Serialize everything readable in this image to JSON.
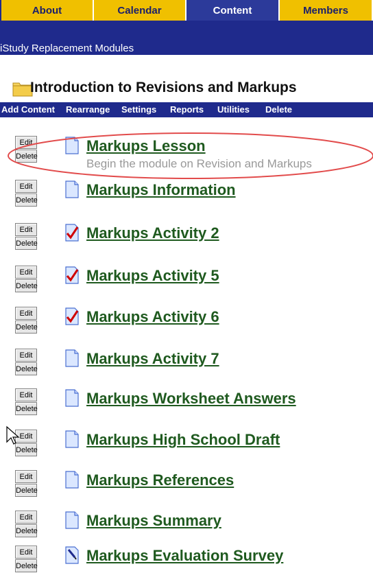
{
  "top_tabs": [
    {
      "label": "About",
      "active": false
    },
    {
      "label": "Calendar",
      "active": false
    },
    {
      "label": "Content",
      "active": true
    },
    {
      "label": "Members",
      "active": false
    }
  ],
  "subheader": {
    "title": "iStudy Replacement Modules"
  },
  "module": {
    "title": "Introduction to Revisions and Markups"
  },
  "toolbar": {
    "items": [
      "Add Content",
      "Rearrange",
      "Settings",
      "Reports",
      "Utilities",
      "Delete"
    ]
  },
  "content_items": [
    {
      "title": "Markups Lesson",
      "description": "Begin the module on Revision and Markups",
      "icon": "page-icon"
    },
    {
      "title": "Markups Information",
      "description": "",
      "icon": "page-icon"
    },
    {
      "title": "Markups Activity 2",
      "description": "",
      "icon": "checkmark-icon"
    },
    {
      "title": "Markups Activity 5",
      "description": "",
      "icon": "checkmark-icon"
    },
    {
      "title": "Markups Activity 6",
      "description": "",
      "icon": "checkmark-icon"
    },
    {
      "title": "Markups Activity 7",
      "description": "",
      "icon": "page-icon"
    },
    {
      "title": "Markups Worksheet Answers",
      "description": "",
      "icon": "page-icon"
    },
    {
      "title": "Markups High School Draft",
      "description": "",
      "icon": "page-icon"
    },
    {
      "title": "Markups References",
      "description": "",
      "icon": "page-icon"
    },
    {
      "title": "Markups Summary",
      "description": "",
      "icon": "page-icon"
    },
    {
      "title": "Markups Evaluation Survey",
      "description": "",
      "icon": "survey-icon"
    }
  ],
  "row_buttons": {
    "edit_label": "Edit",
    "delete_label": "Delete"
  },
  "colors": {
    "nav_bar": "#1f2a8c",
    "tab_inactive": "#f0c000",
    "tab_active": "#2c3a9a",
    "link_green": "#1f5a1f",
    "highlight_ellipse": "#e24b4b"
  }
}
